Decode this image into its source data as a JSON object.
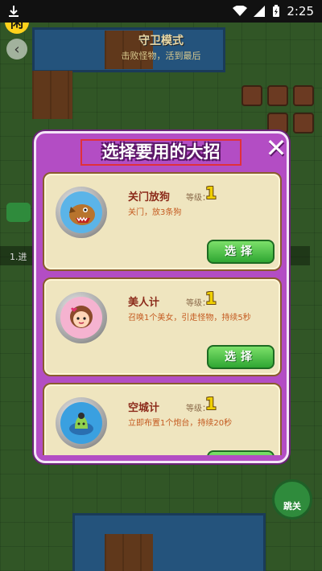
{
  "status_bar": {
    "time": "2:25",
    "icons": [
      "download-icon",
      "wifi-icon",
      "cell-signal-icon",
      "battery-charging-icon"
    ]
  },
  "background": {
    "app_logo_text": "闲",
    "mode_title": "守卫模式",
    "mode_subtitle": "击败怪物，活到最后",
    "level_strip_text": "1.进",
    "skip_label": "跳关"
  },
  "dialog": {
    "title": "选择要用的大招",
    "close_icon": "close-icon",
    "level_label": "等级：",
    "select_label": "选择",
    "skills": [
      {
        "name": "关门放狗",
        "level": "1",
        "desc": "关门，放3条狗",
        "icon": "dog-icon"
      },
      {
        "name": "美人计",
        "level": "1",
        "desc": "召唤1个美女，引走怪物，持续5秒",
        "icon": "beauty-icon"
      },
      {
        "name": "空城计",
        "level": "1",
        "desc": "立即布置1个炮台，持续20秒",
        "icon": "turret-icon"
      }
    ]
  },
  "colors": {
    "dialog_bg": "#b34dc4",
    "card_bg": "#efe5bf",
    "button_green": "#2fa632",
    "level_yellow": "#f0d000"
  }
}
